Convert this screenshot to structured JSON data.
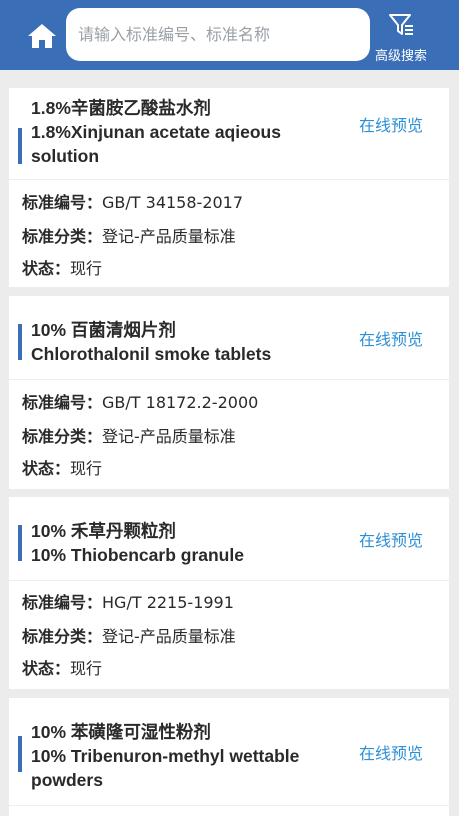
{
  "header": {
    "search_placeholder": "请输入标准编号、标准名称",
    "advanced_label": "高级搜索"
  },
  "labels": {
    "number": "标准编号：",
    "category": "标准分类：",
    "status": "状态："
  },
  "items": [
    {
      "title_zh": "1.8%辛菌胺乙酸盐水剂",
      "title_en": "1.8%Xinjunan acetate aqieous solution",
      "preview": "在线预览",
      "number": "GB/T 34158-2017",
      "category": "登记-产品质量标准",
      "status": "现行"
    },
    {
      "title_zh": "10% 百菌清烟片剂",
      "title_en": "Chlorothalonil smoke tablets",
      "preview": "在线预览",
      "number": "GB/T 18172.2-2000",
      "category": "登记-产品质量标准",
      "status": "现行"
    },
    {
      "title_zh": "10% 禾草丹颗粒剂",
      "title_en": "10% Thiobencarb granule",
      "preview": "在线预览",
      "number": "HG/T 2215-1991",
      "category": "登记-产品质量标准",
      "status": "现行"
    },
    {
      "title_zh": "10% 苯磺隆可湿性粉剂",
      "title_en": "10% Tribenuron-methyl wettable powders",
      "preview": "在线预览"
    }
  ]
}
